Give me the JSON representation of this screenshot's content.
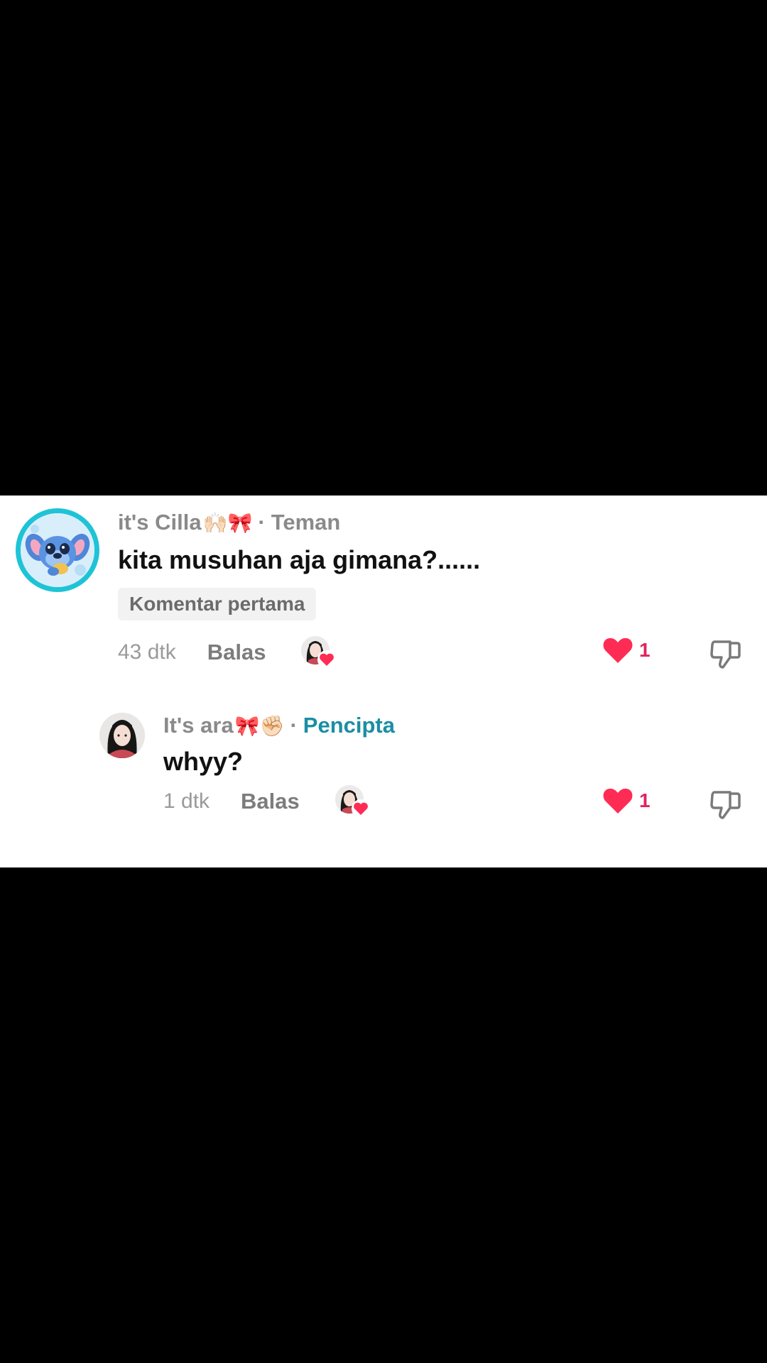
{
  "comments": [
    {
      "username": "it's Cilla",
      "username_emoji": "🙌🏻🎀",
      "relation_badge": "Teman",
      "text": "kita musuhan aja gimana?......",
      "tag": "Komentar pertama",
      "time": "43 dtk",
      "reply_label": "Balas",
      "like_count": "1"
    },
    {
      "username": "It's ara",
      "username_emoji": "🎀✊🏻",
      "relation_badge": "Pencipta",
      "text": "whyy?",
      "time": "1 dtk",
      "reply_label": "Balas",
      "like_count": "1"
    }
  ],
  "separator": "·",
  "colors": {
    "background": "#000000",
    "panel": "#ffffff",
    "like_red": "#fe2c55",
    "creator_teal": "#1b8ea3",
    "avatar_ring": "#1fc3d6"
  },
  "icons": {
    "like": "heart-icon",
    "dislike": "thumbs-down-icon",
    "creator_liked": "creator-liked-heart-icon"
  }
}
